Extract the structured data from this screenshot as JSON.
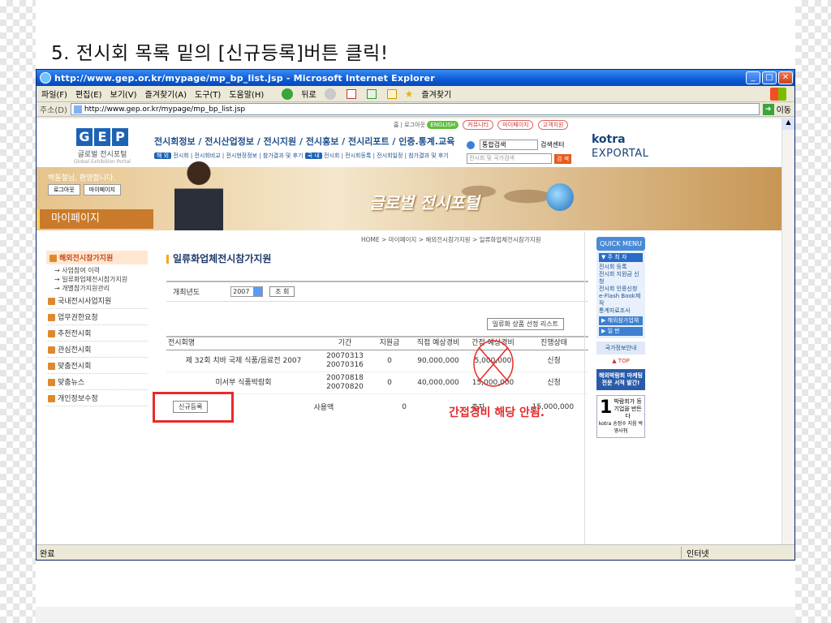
{
  "slide": {
    "title": "5. 전시회 목록 밑의 [신규등록]버튼 클릭!"
  },
  "window": {
    "title": "http://www.gep.or.kr/mypage/mp_bp_list.jsp - Microsoft Internet Explorer",
    "menu": [
      "파일(F)",
      "편집(E)",
      "보기(V)",
      "즐겨찾기(A)",
      "도구(T)",
      "도움말(H)"
    ],
    "nav": {
      "back": "뒤로",
      "favorites": "즐겨찾기"
    },
    "address_label": "주소(D)",
    "address": "http://www.gep.or.kr/mypage/mp_bp_list.jsp",
    "go": "이동",
    "status": "완료",
    "zone": "인터넷"
  },
  "site": {
    "logo": {
      "letters": [
        "G",
        "E",
        "P"
      ],
      "name": "글로벌 전시포털",
      "sub": "Global Exhibition Portal"
    },
    "top_links": {
      "home": "홈",
      "logout": "로그아웃",
      "english": "ENGLISH",
      "community": "커뮤니티",
      "mypage": "마이페이지",
      "cs": "고객지원"
    },
    "top_nav": "전시회정보 / 전시산업정보 / 전시지원 / 전시홍보 / 전시리포트 / 인증.통계.교육",
    "sub_nav_overseas": "해 외",
    "sub_nav_a": "전시회 | 전시회비교 | 전시현장정보 | 참가결과 및 후기",
    "sub_nav_domestic": "국 내",
    "sub_nav_b": "전시회 | 전시회등록 | 전시회일정 | 참가결과 및 후기",
    "search": {
      "scope": "통합검색",
      "center": "검색센터",
      "placeholder": "전시회 및 국가검색",
      "button": "검 색"
    },
    "kotra": "kotra",
    "export": "EXPORTAL",
    "greeting": "벽돌철님, 환영합니다.",
    "logout_btn": "로그아웃",
    "mypage_btn": "마이페이지",
    "mypage_title": "마이페이지",
    "brand": "글로벌 전시포털"
  },
  "sidebar": {
    "header": "해외전시참가지원",
    "subitems": [
      "→ 사업참여 이력",
      "→ 일류화업체전시참가지원",
      "→ 개별참가지원관리"
    ],
    "items": [
      "국내전시사업지원",
      "업무권한요청",
      "추천전시회",
      "관심전시회",
      "맞춤전시회",
      "맞춤뉴스",
      "개인정보수정"
    ]
  },
  "content": {
    "breadcrumb": "HOME > 마이페이지 > 해외전시참가지원 > 일류화업체전시참가지원",
    "title": "일류화업체전시참가지원",
    "year_label": "개최년도",
    "year_value": "2007",
    "search_btn": "조 회",
    "list_btn": "일류화 상품 선정 리스트",
    "columns": [
      "전시회명",
      "기간",
      "지원금",
      "직접 예상경비",
      "간접 예상경비",
      "진행상태"
    ],
    "rows": [
      {
        "name": "제 32회 치바 국제 식품/음료전 2007",
        "start": "20070313",
        "end": "20070316",
        "support": "0",
        "direct": "90,000,000",
        "indirect": "5,000,000",
        "status": "신청"
      },
      {
        "name": "미서부 식품박람회",
        "start": "20070818",
        "end": "20070820",
        "support": "0",
        "direct": "40,000,000",
        "indirect": "15,000,000",
        "status": "신청"
      }
    ],
    "new_btn": "신규등록",
    "used_label": "사용액",
    "used_value": "0",
    "incr_label": "증자",
    "incr_value": "15,000,000",
    "note": "간접경비 해당 안됨."
  },
  "quick": {
    "title": "QUICK MENU",
    "section": "▼ 주 최 자",
    "links": [
      "전시회 등록",
      "전시회 지원금 신청",
      "전시회 인증신청",
      "e-Flash Book제작",
      "통계자료조사"
    ],
    "b1": "▶ 해외참가업체",
    "b2": "▶ 일 반",
    "nation": "국가정보안내",
    "top": "▲ TOP",
    "ad1": "해외박람회 마케팅 전문 서적 발간!",
    "ad2_big": "1",
    "ad2_text": "박람회가 등기업을 반든다",
    "ad2_sub": "kotra 송정수 지음 박영사刊"
  }
}
